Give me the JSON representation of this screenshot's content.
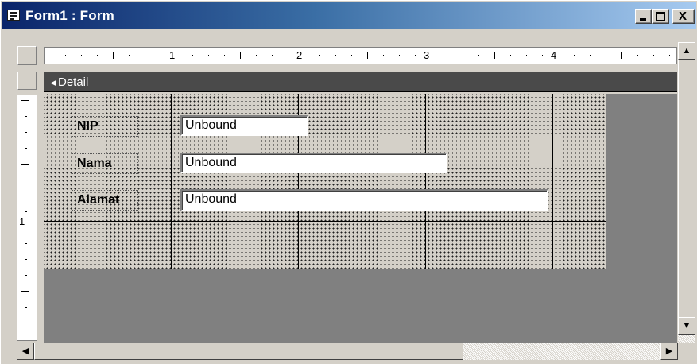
{
  "window": {
    "title": "Form1 : Form",
    "buttons": {
      "minimize": "_",
      "maximize": "□",
      "close": "X"
    }
  },
  "ruler": {
    "horizontal_numbers": [
      "1",
      "2",
      "3",
      "4"
    ],
    "vertical_numbers": [
      "1"
    ]
  },
  "section": {
    "detail_label": "Detail"
  },
  "form": {
    "fields": [
      {
        "label": "NIP",
        "value": "Unbound"
      },
      {
        "label": "Nama",
        "value": "Unbound"
      },
      {
        "label": "Alamat",
        "value": "Unbound"
      }
    ]
  },
  "colors": {
    "titlebar_start": "#0a246a",
    "titlebar_end": "#a6caf0",
    "face": "#d4d0c8",
    "canvas": "#808080"
  },
  "icons": [
    "form-icon",
    "minimize-icon",
    "maximize-icon",
    "close-icon",
    "detail-collapse-icon",
    "scroll-up-icon",
    "scroll-down-icon",
    "scroll-left-icon",
    "scroll-right-icon"
  ]
}
